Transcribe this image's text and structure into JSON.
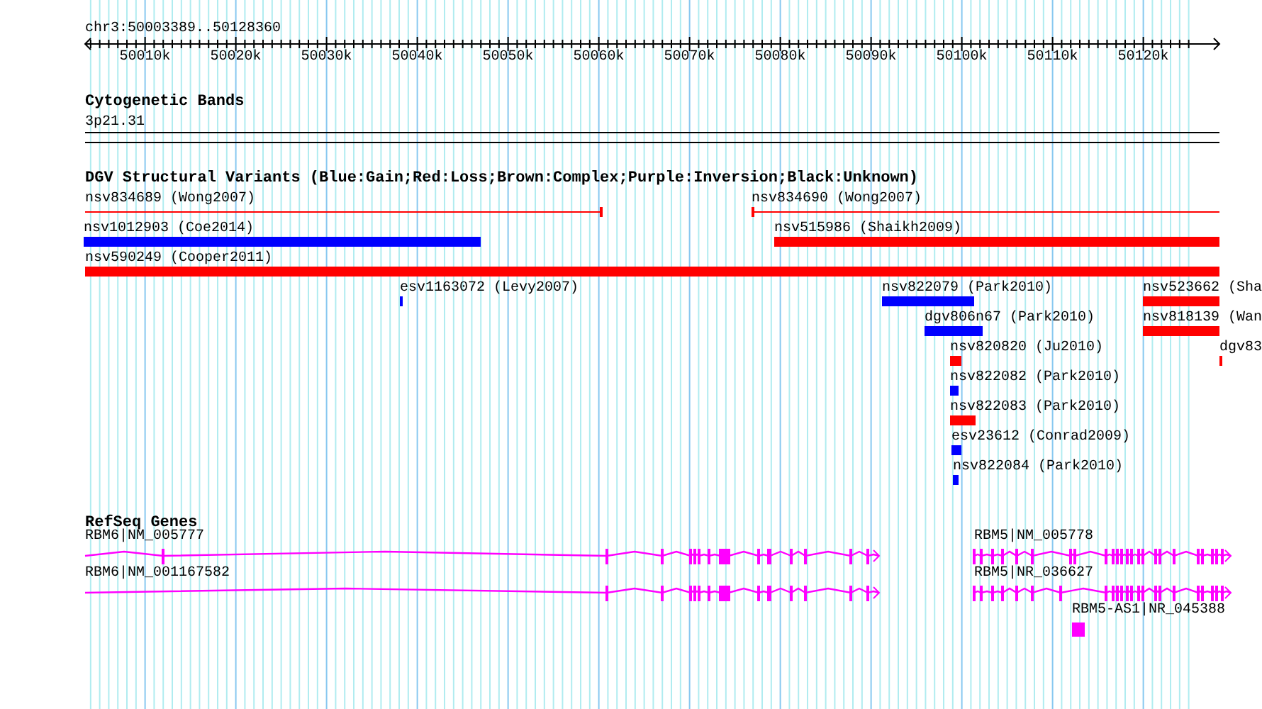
{
  "ruler": {
    "range": "chr3:50003389..50128360",
    "ticks": [
      "50010k",
      "50020k",
      "50030k",
      "50040k",
      "50050k",
      "50060k",
      "50070k",
      "50080k",
      "50090k",
      "50100k",
      "50110k",
      "50120k"
    ]
  },
  "tracks": [
    {
      "kind": "bands",
      "title": "Cytogenetic Bands",
      "features": [
        {
          "label": "3p21.31"
        }
      ]
    },
    {
      "kind": "variants",
      "title": "DGV Structural Variants (Blue:Gain;Red:Loss;Brown:Complex;Purple:Inversion;Black:Unknown)",
      "features": [
        {
          "label": "nsv834689 (Wong2007)",
          "kind": "line",
          "color": "#ff0000"
        },
        {
          "label": "nsv834690 (Wong2007)",
          "kind": "line",
          "color": "#ff0000"
        },
        {
          "label": "nsv1012903 (Coe2014)",
          "kind": "bar",
          "color": "#0000ff"
        },
        {
          "label": "nsv515986 (Shaikh2009)",
          "kind": "bar",
          "color": "#ff0000"
        },
        {
          "label": "nsv590249 (Cooper2011)",
          "kind": "bar",
          "color": "#ff0000"
        },
        {
          "label": "esv1163072 (Levy2007)",
          "kind": "bar",
          "color": "#0000ff"
        },
        {
          "label": "nsv822079 (Park2010)",
          "kind": "bar",
          "color": "#0000ff"
        },
        {
          "label": "nsv523662 (Sha",
          "kind": "bar",
          "color": "#ff0000"
        },
        {
          "label": "dgv806n67 (Park2010)",
          "kind": "bar",
          "color": "#0000ff"
        },
        {
          "label": "nsv818139 (Wan",
          "kind": "bar",
          "color": "#ff0000"
        },
        {
          "label": "nsv820820 (Ju2010)",
          "kind": "bar",
          "color": "#ff0000"
        },
        {
          "label": "dgv83",
          "kind": "bar",
          "color": "#ff0000"
        },
        {
          "label": "nsv822082 (Park2010)",
          "kind": "bar",
          "color": "#0000ff"
        },
        {
          "label": "nsv822083 (Park2010)",
          "kind": "bar",
          "color": "#ff0000"
        },
        {
          "label": "esv23612 (Conrad2009)",
          "kind": "bar",
          "color": "#0000ff"
        },
        {
          "label": "nsv822084 (Park2010)",
          "kind": "bar",
          "color": "#0000ff"
        }
      ]
    },
    {
      "kind": "genes",
      "title": "RefSeq Genes",
      "features": [
        {
          "label": "RBM6|NM_005777",
          "kind": "transcript"
        },
        {
          "label": "RBM6|NM_001167582",
          "kind": "transcript"
        },
        {
          "label": "RBM5|NM_005778",
          "kind": "transcript"
        },
        {
          "label": "RBM5|NR_036627",
          "kind": "transcript"
        },
        {
          "label": "RBM5-AS1|NR_045388",
          "kind": "exon"
        }
      ]
    }
  ]
}
